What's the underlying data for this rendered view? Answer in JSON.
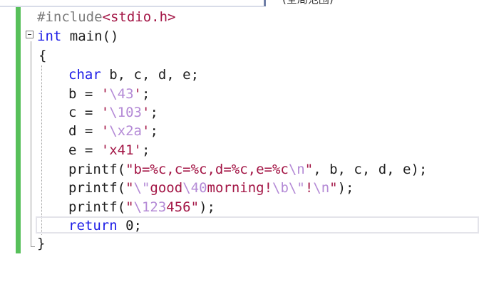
{
  "tab": {
    "label": "(全局范围)"
  },
  "code": {
    "line1": {
      "directive": "#include",
      "header": "<stdio.h>"
    },
    "line2": {
      "type": "int",
      "name": "main",
      "parens": "()"
    },
    "line3": {
      "text": "{"
    },
    "line4": {
      "type": "char",
      "vars": "b, c, d, e;"
    },
    "line5": {
      "lhs": "b = ",
      "q1": "'",
      "esc": "\\43",
      "q2": "'",
      "end": ";"
    },
    "line6": {
      "lhs": "c = ",
      "q1": "'",
      "esc": "\\103",
      "q2": "'",
      "end": ";"
    },
    "line7": {
      "lhs": "d = ",
      "q1": "'",
      "esc": "\\x2a",
      "q2": "'",
      "end": ";"
    },
    "line8": {
      "lhs": "e = ",
      "str": "'x41'",
      "end": ";"
    },
    "line9": {
      "fn": "printf(",
      "str1": "\"b=%c,c=%c,d=%c,e=%c",
      "esc": "\\n",
      "str2": "\"",
      "args": ", b, c, d, e);"
    },
    "line10": {
      "fn": "printf(",
      "s1": "\"",
      "e1": "\\\"",
      "s2": "good",
      "e2": "\\40",
      "s3": "morning!",
      "e3": "\\b",
      "e4": "\\\"",
      "s4": "!",
      "e5": "\\n",
      "s5": "\"",
      "end": ");"
    },
    "line11": {
      "fn": "printf(",
      "s1": "\"",
      "esc": "\\123",
      "s2": "456\"",
      "end": ");"
    },
    "line12": {
      "kw": "return",
      "val": "0",
      "end": ";"
    },
    "line13": {
      "text": "}"
    }
  },
  "colors": {
    "keyword": "#1c1ce6",
    "preprocessor": "#7b7b7b",
    "string": "#a31545",
    "escape": "#b48ad6",
    "change_bar": "#57c05a"
  }
}
